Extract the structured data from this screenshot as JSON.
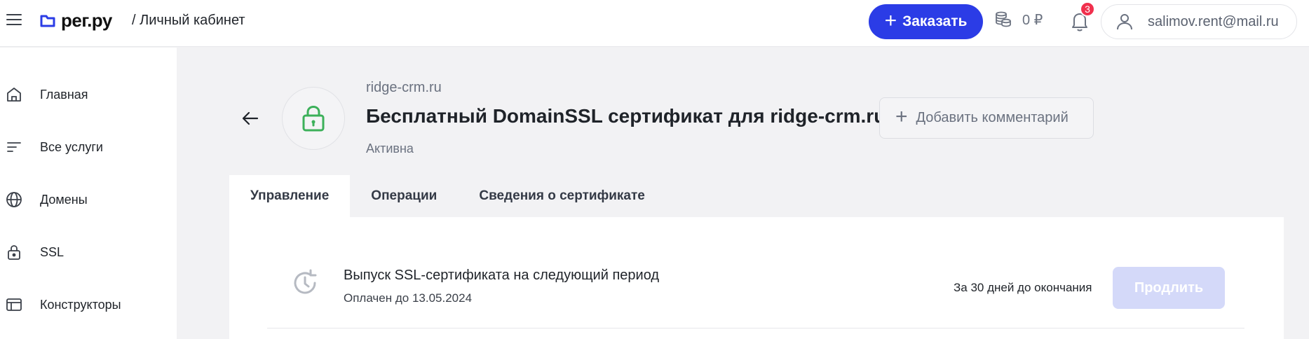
{
  "header": {
    "logo_text": "рег.ру",
    "breadcrumb": "/ Личный кабинет",
    "order_label": "Заказать",
    "balance": "0 ₽",
    "notifications_count": "3",
    "user_email": "salimov.rent@mail.ru",
    "accent_color": "#2b3ce6"
  },
  "sidebar": {
    "items": [
      {
        "label": "Главная",
        "icon": "home-icon"
      },
      {
        "label": "Все услуги",
        "icon": "list-icon"
      },
      {
        "label": "Домены",
        "icon": "globe-icon"
      },
      {
        "label": "SSL",
        "icon": "lock-icon"
      },
      {
        "label": "Конструкторы",
        "icon": "browser-window-icon"
      }
    ]
  },
  "service": {
    "domain": "ridge-crm.ru",
    "title": "Бесплатный DomainSSL сертификат для ridge-crm.ru",
    "status": "Активна",
    "add_comment_label": "Добавить комментарий",
    "lock_color": "#3cb05a"
  },
  "tabs": [
    {
      "label": "Управление",
      "active": true
    },
    {
      "label": "Операции",
      "active": false
    },
    {
      "label": "Сведения о сертификате",
      "active": false
    }
  ],
  "renewal": {
    "title": "Выпуск SSL-сертификата на следующий период",
    "paid_until": "Оплачен до 13.05.2024",
    "note": "За 30 дней до окончания",
    "button_label": "Продлить"
  }
}
